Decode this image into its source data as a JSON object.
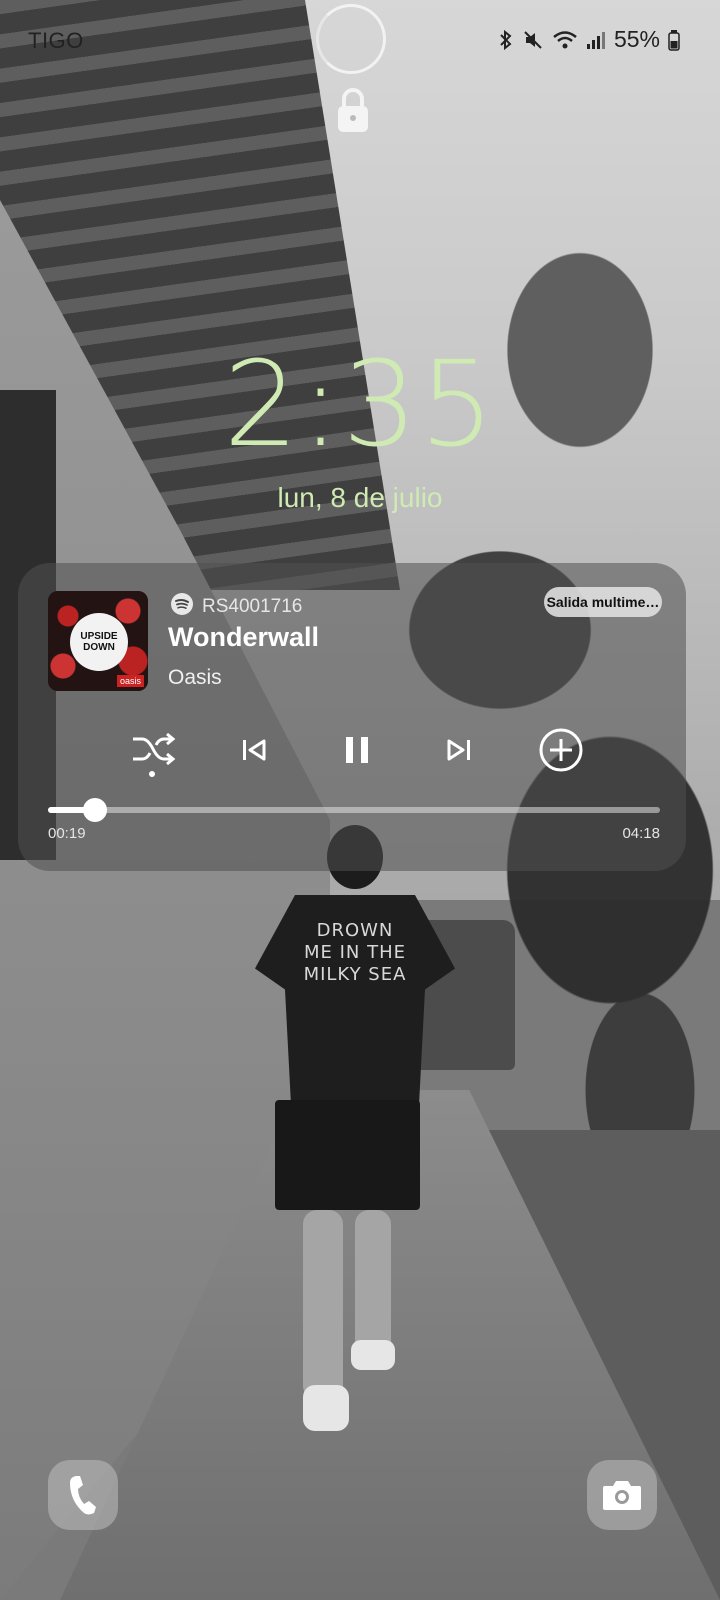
{
  "status_bar": {
    "carrier": "TIGO",
    "battery_percent": "55%",
    "icons": [
      "bluetooth-icon",
      "mute-icon",
      "wifi-icon",
      "signal-icon",
      "battery-icon"
    ]
  },
  "lock": {
    "icon": "padlock-icon"
  },
  "clock": {
    "time": "2:35",
    "date": "lun, 8 de julio",
    "color": "#cfeab3"
  },
  "media": {
    "source_app": "spotify",
    "source_name": "RS4001716",
    "output_button": "Salida multime…",
    "song_title": "Wonderwall",
    "artist": "Oasis",
    "album_art": {
      "title": "UPSIDE DOWN",
      "tag": "oasis"
    },
    "controls": [
      "shuffle-icon",
      "previous-icon",
      "pause-icon",
      "next-icon",
      "add-icon"
    ],
    "elapsed": "00:19",
    "total": "04:18",
    "progress_fraction": 0.076
  },
  "wallpaper_text": {
    "shirt_print": "DROWN ME IN THE MILKY SEA"
  },
  "shortcuts": [
    "phone-icon",
    "camera-icon"
  ]
}
